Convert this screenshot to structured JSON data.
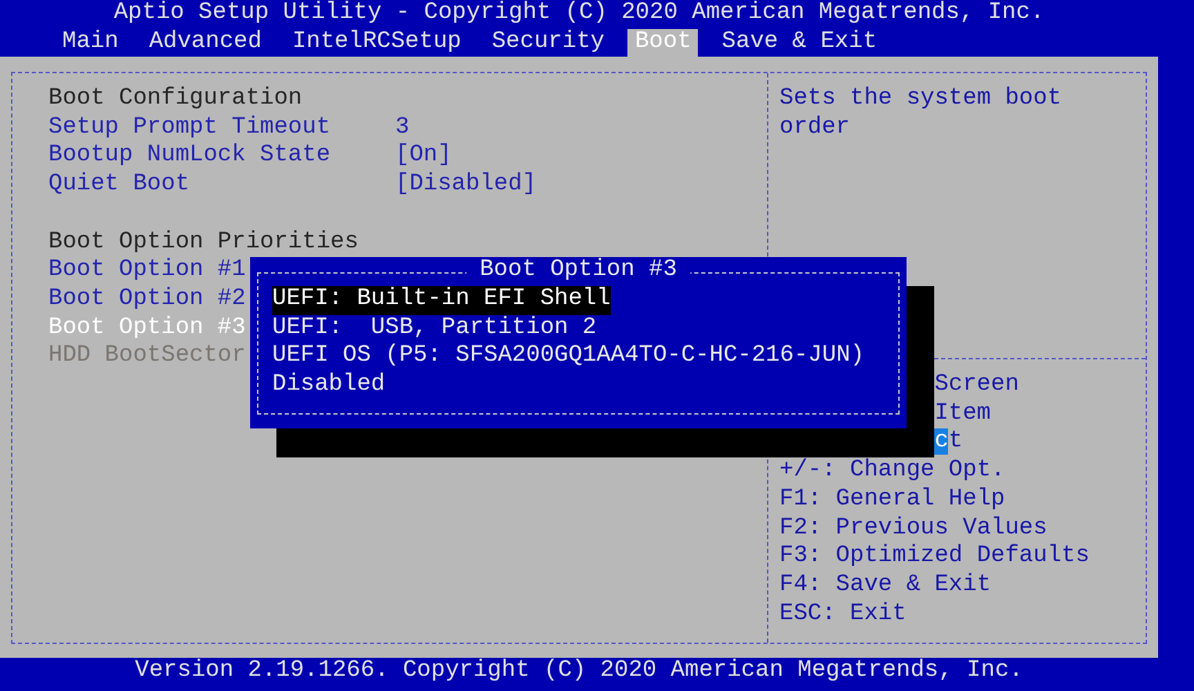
{
  "window": {
    "title": "Aptio Setup Utility - Copyright (C) 2020 American Megatrends, Inc."
  },
  "tabs": [
    {
      "label": "Main",
      "selected": false
    },
    {
      "label": "Advanced",
      "selected": false
    },
    {
      "label": "IntelRCSetup",
      "selected": false
    },
    {
      "label": "Security",
      "selected": false
    },
    {
      "label": "Boot",
      "selected": true
    },
    {
      "label": "Save & Exit",
      "selected": false
    }
  ],
  "settings": {
    "sections": [
      {
        "title": "Boot Configuration",
        "items": [
          {
            "label": "Setup Prompt Timeout",
            "value": "3",
            "kind": "option",
            "selected": false
          },
          {
            "label": "Bootup NumLock State",
            "value": "[On]",
            "kind": "option",
            "selected": false
          },
          {
            "label": "Quiet Boot",
            "value": "[Disabled]",
            "kind": "option",
            "selected": false
          }
        ]
      },
      {
        "title": "Boot Option Priorities",
        "items": [
          {
            "label": "Boot Option #1",
            "kind": "option",
            "selected": false
          },
          {
            "label": "Boot Option #2",
            "kind": "option",
            "selected": false
          },
          {
            "label": "Boot Option #3",
            "kind": "option",
            "selected": true
          },
          {
            "label": "HDD BootSector",
            "kind": "info",
            "selected": false
          }
        ]
      }
    ]
  },
  "help": {
    "text": "Sets the system boot order",
    "keys": [
      {
        "text": "Screen",
        "covered": true,
        "cursor": false
      },
      {
        "text": "Item",
        "covered": true,
        "cursor": false
      },
      {
        "text": "ct",
        "covered": true,
        "cursor": true
      },
      {
        "text": "+/-: Change Opt.",
        "covered": false,
        "cursor": false
      },
      {
        "text": "F1: General Help",
        "covered": false,
        "cursor": false
      },
      {
        "text": "F2: Previous Values",
        "covered": false,
        "cursor": false
      },
      {
        "text": "F3: Optimized Defaults",
        "covered": false,
        "cursor": false
      },
      {
        "text": "F4: Save & Exit",
        "covered": false,
        "cursor": false
      },
      {
        "text": "ESC: Exit",
        "covered": false,
        "cursor": false
      }
    ]
  },
  "popup": {
    "title": "Boot Option #3",
    "options": [
      {
        "label": "UEFI: Built-in EFI Shell",
        "selected": true
      },
      {
        "label": "UEFI:  USB, Partition 2",
        "selected": false
      },
      {
        "label": "UEFI OS (P5: SFSA200GQ1AA4TO-C-HC-216-JUN)",
        "selected": false
      },
      {
        "label": "Disabled",
        "selected": false
      }
    ]
  },
  "footer": {
    "text": "Version 2.19.1266. Copyright (C) 2020 American Megatrends, Inc."
  }
}
